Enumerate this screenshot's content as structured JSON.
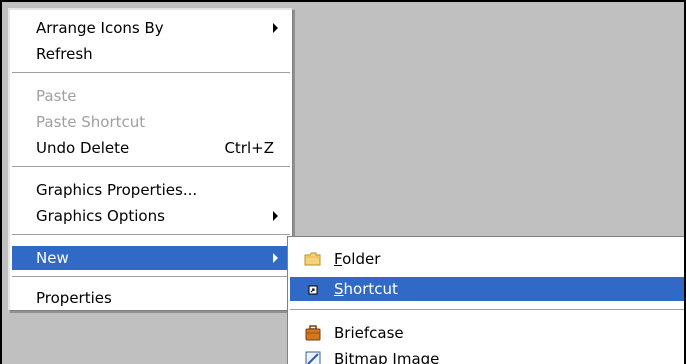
{
  "context_menu": {
    "items": [
      {
        "label": "Arrange Icons By",
        "has_submenu": true
      },
      {
        "label": "Refresh"
      },
      {
        "label": "Paste",
        "disabled": true
      },
      {
        "label": "Paste Shortcut",
        "disabled": true
      },
      {
        "label": "Undo Delete",
        "shortcut": "Ctrl+Z"
      },
      {
        "label": "Graphics Properties..."
      },
      {
        "label": "Graphics Options",
        "has_submenu": true
      },
      {
        "label": "New",
        "has_submenu": true,
        "highlighted": true
      },
      {
        "label": "Properties"
      }
    ]
  },
  "new_submenu": {
    "items": [
      {
        "label_mnemonic": "F",
        "label_rest": "older",
        "icon": "folder-icon"
      },
      {
        "label_mnemonic": "S",
        "label_rest": "hortcut",
        "icon": "shortcut-icon",
        "highlighted": true
      },
      {
        "label_mnemonic": "",
        "label_rest": "Briefcase",
        "icon": "briefcase-icon"
      },
      {
        "label_mnemonic": "",
        "label_rest": "Bitmap Image",
        "icon": "bitmap-image-icon"
      }
    ]
  },
  "colors": {
    "highlight": "#3169c6",
    "menu_background": "#ffffff",
    "desktop_background": "#c0c0c0",
    "disabled_text": "#a0a0a0"
  }
}
